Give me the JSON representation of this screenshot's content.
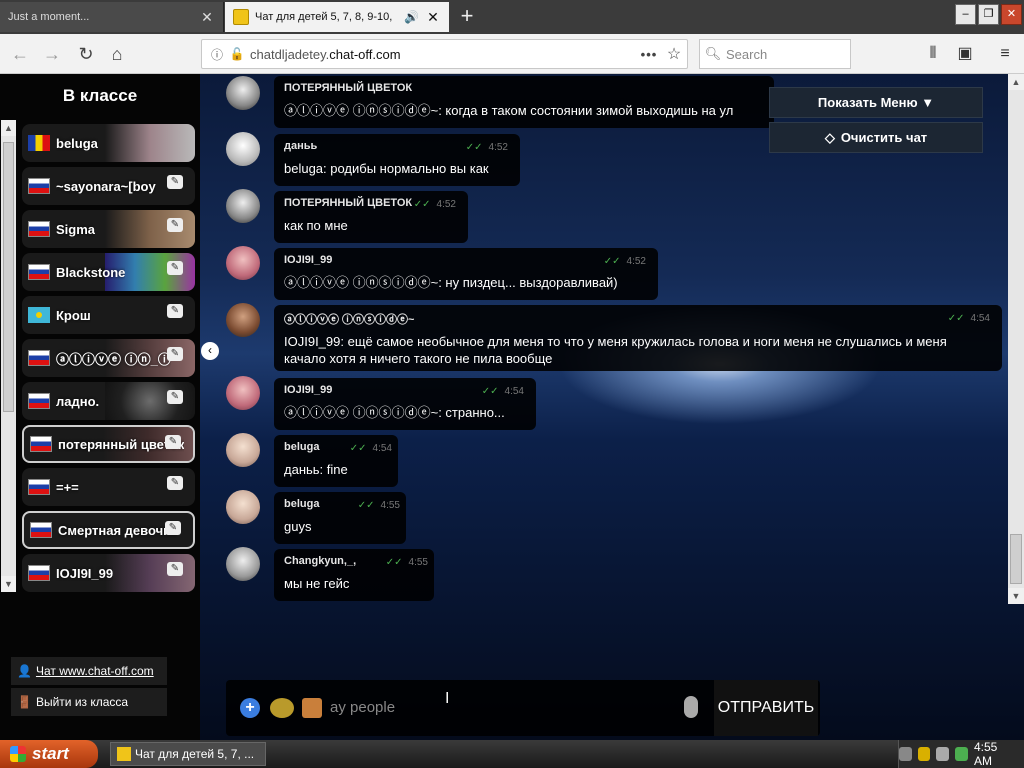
{
  "browser": {
    "tabs": [
      {
        "title": "Just a moment...",
        "close": "✕"
      },
      {
        "title": "Чат для детей 5, 7, 8, 9-10,",
        "close": "✕"
      }
    ],
    "new_tab": "+",
    "window_buttons": [
      "–",
      "❐",
      "✕"
    ],
    "url_domain": "chatdljadetey.",
    "url_host": "chat-off.com",
    "search_placeholder": "Search",
    "page_actions": "•••"
  },
  "sidebar": {
    "title": "В классе",
    "users": [
      {
        "name": "beluga",
        "flag": "ro"
      },
      {
        "name": "~sayonara~[boy",
        "flag": "ru"
      },
      {
        "name": "Sigma",
        "flag": "ru"
      },
      {
        "name": "Blackstone",
        "flag": "ru"
      },
      {
        "name": "Крош",
        "flag": "kz"
      },
      {
        "name": "ⓐⓛⓘⓥⓔ ⓘⓝ_ⓘ",
        "flag": "ru"
      },
      {
        "name": "ладно.",
        "flag": "ru"
      },
      {
        "name": "потерянный цветок",
        "flag": "ru"
      },
      {
        "name": "=+=",
        "flag": "ru"
      },
      {
        "name": "Смертная девочка",
        "flag": "ru"
      },
      {
        "name": "IOJI9I_99",
        "flag": "ru"
      }
    ],
    "links": [
      {
        "icon": "👤",
        "label": "Чат www.chat-off.com"
      },
      {
        "icon": "🚪",
        "label": "Выйти из класса"
      }
    ]
  },
  "menu": {
    "show_menu": "Показать Меню ▼",
    "clear_chat": "Очистить чат"
  },
  "messages": [
    {
      "author": "ПОТЕРЯННЫЙ ЦВЕТОК",
      "time": "",
      "text": "ⓐⓛⓘⓥⓔ ⓘⓝⓢⓘⓓⓔ~: когда в таком состоянии зимой выходишь на ул"
    },
    {
      "author": "даньь",
      "time": "4:52",
      "text": "beluga: родибы нормально вы как"
    },
    {
      "author": "ПОТЕРЯННЫЙ ЦВЕТОК",
      "time": "4:52",
      "text": "как по мне"
    },
    {
      "author": "IOJI9I_99",
      "time": "4:52",
      "text": "ⓐⓛⓘⓥⓔ ⓘⓝⓢⓘⓓⓔ~: ну пиздец... выздоравливай)"
    },
    {
      "author": "ⓐⓛⓘⓥⓔ ⓘⓝⓢⓘⓓⓔ~",
      "time": "4:54",
      "text": "IOJI9I_99: ещё самое необычное для меня то что у меня кружилась голова и ноги меня не слушались и меня качало хотя я ничего такого не пила вообще"
    },
    {
      "author": "IOJI9I_99",
      "time": "4:54",
      "text": "ⓐⓛⓘⓥⓔ ⓘⓝⓢⓘⓓⓔ~: странно..."
    },
    {
      "author": "beluga",
      "time": "4:54",
      "text": "даньь: fine"
    },
    {
      "author": "beluga",
      "time": "4:55",
      "text": "guys"
    },
    {
      "author": "Changkyun,_,",
      "time": "4:55",
      "text": "мы не гейс"
    }
  ],
  "input": {
    "value": "ay people",
    "send_label": "ОТПРАВИТЬ"
  },
  "taskbar": {
    "start": "start",
    "task_title": "Чат для детей 5, 7, ...",
    "clock": "4:55 AM"
  }
}
